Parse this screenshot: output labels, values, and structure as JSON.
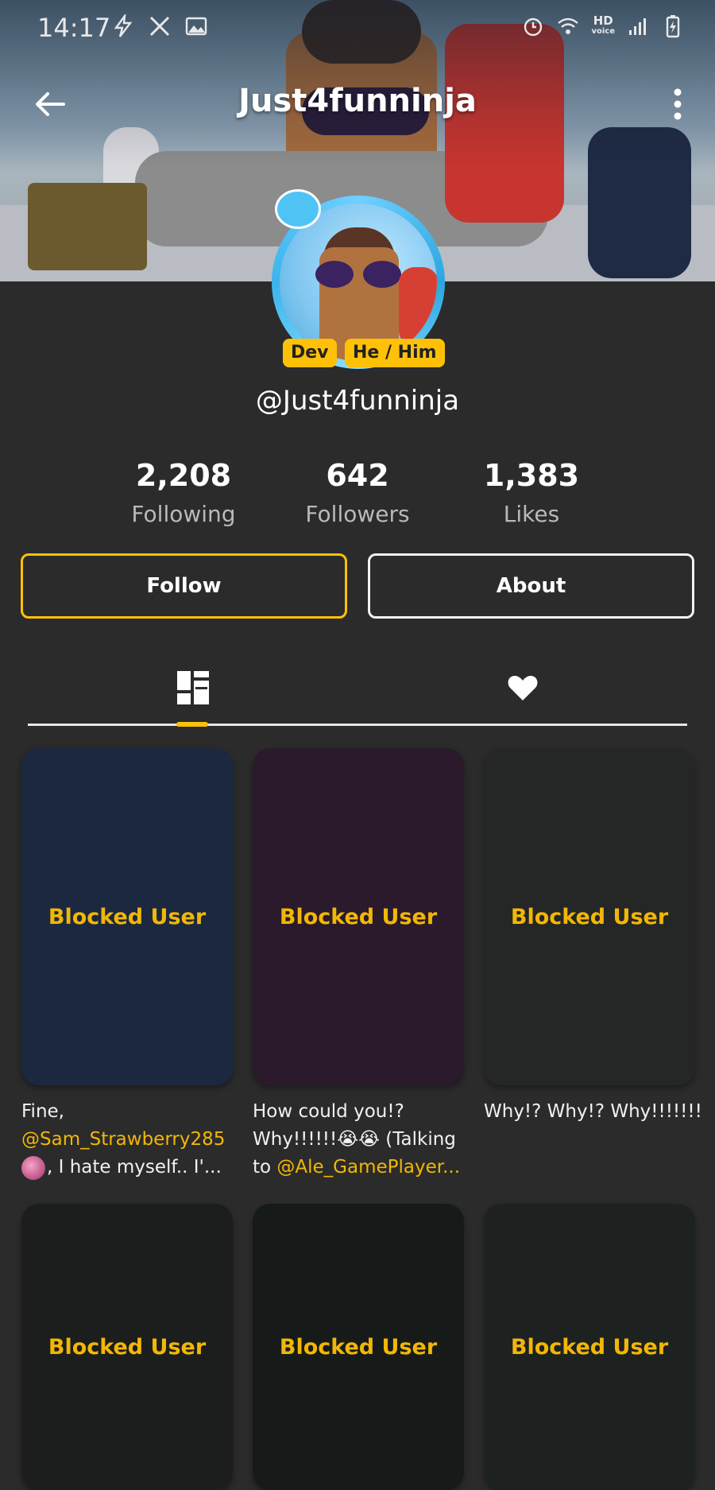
{
  "status_bar": {
    "time": "14:17",
    "left_icons": [
      "flash-icon",
      "x-logo-icon",
      "gallery-icon"
    ],
    "right_icons": [
      "alarm-icon",
      "wifi-icon",
      "hd-voice-icon",
      "signal-icon",
      "battery-charging-icon"
    ],
    "hd_top": "HD",
    "hd_bottom": "voice"
  },
  "header": {
    "title": "Just4funninja"
  },
  "profile": {
    "tags": [
      "Dev",
      "He / Him"
    ],
    "handle": "@Just4funninja",
    "stats": [
      {
        "value": "2,208",
        "label": "Following"
      },
      {
        "value": "642",
        "label": "Followers"
      },
      {
        "value": "1,383",
        "label": "Likes"
      }
    ],
    "follow_label": "Follow",
    "about_label": "About"
  },
  "tabs": [
    {
      "name": "posts-grid-icon",
      "active": true
    },
    {
      "name": "heart-icon",
      "active": false
    }
  ],
  "posts": [
    {
      "overlay": "Blocked User",
      "bg": "#1b2840"
    },
    {
      "overlay": "Blocked User",
      "bg": "#2a1a2b"
    },
    {
      "overlay": "Blocked User",
      "bg": "#252626"
    },
    {
      "overlay": "Blocked User",
      "bg": "#1b1e1d"
    },
    {
      "overlay": "Blocked User",
      "bg": "#161b19"
    },
    {
      "overlay": "Blocked User",
      "bg": "#1d2120"
    }
  ],
  "captions": {
    "c1_line1": "Fine,",
    "c1_mention": "@Sam_Strawberry285",
    "c1_line3": ", I hate myself.. I'...",
    "c2_line1": "How could you!?",
    "c2_line2": "Why!!!!!!😭😭 (Talking",
    "c2_to": "to ",
    "c2_mention": "@Ale_GamePlayer...",
    "c3_line1": "Why!? Why!? Why!!!!!!!"
  },
  "colors": {
    "accent": "#ffc107",
    "background": "#2b2b2b",
    "blocked_text": "#f2b705"
  }
}
